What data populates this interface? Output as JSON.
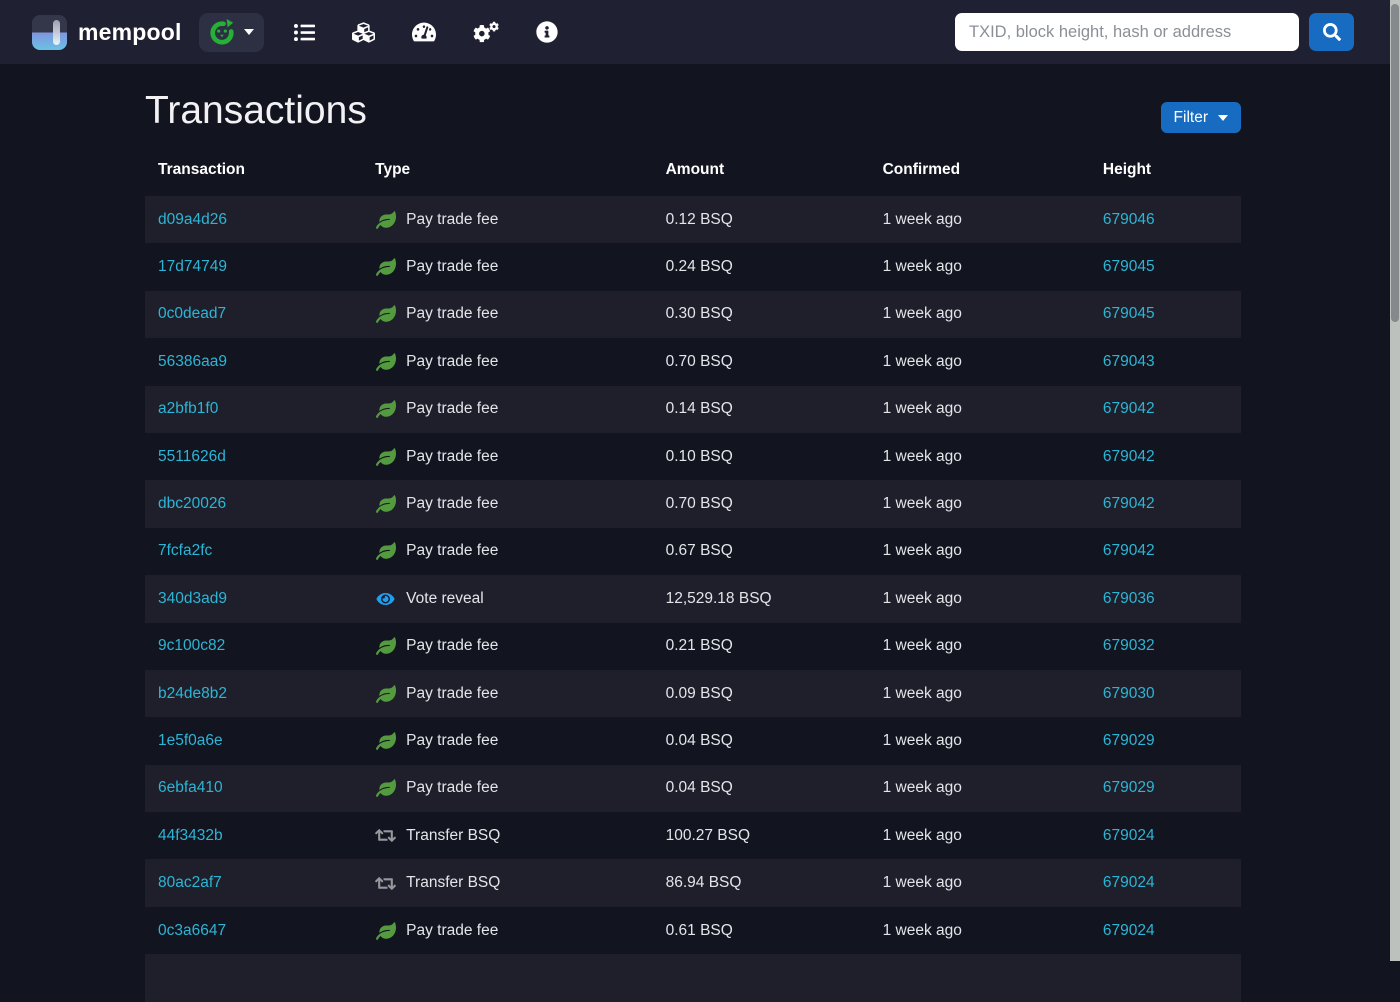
{
  "header": {
    "brand": "mempool",
    "network_selector": {
      "selected_network": "bisq"
    },
    "nav_icons": [
      {
        "name": "transactions-list-icon"
      },
      {
        "name": "blocks-icon"
      },
      {
        "name": "dashboard-icon"
      },
      {
        "name": "settings-icon"
      },
      {
        "name": "about-icon"
      }
    ],
    "search_placeholder": "TXID, block height, hash or address"
  },
  "page": {
    "title": "Transactions",
    "filter_label": "Filter"
  },
  "table": {
    "columns": [
      "Transaction",
      "Type",
      "Amount",
      "Confirmed",
      "Height"
    ],
    "rows": [
      {
        "txid": "d09a4d26",
        "icon": "leaf",
        "type": "Pay trade fee",
        "amount": "0.12 BSQ",
        "confirmed": "1 week ago",
        "height": "679046"
      },
      {
        "txid": "17d74749",
        "icon": "leaf",
        "type": "Pay trade fee",
        "amount": "0.24 BSQ",
        "confirmed": "1 week ago",
        "height": "679045"
      },
      {
        "txid": "0c0dead7",
        "icon": "leaf",
        "type": "Pay trade fee",
        "amount": "0.30 BSQ",
        "confirmed": "1 week ago",
        "height": "679045"
      },
      {
        "txid": "56386aa9",
        "icon": "leaf",
        "type": "Pay trade fee",
        "amount": "0.70 BSQ",
        "confirmed": "1 week ago",
        "height": "679043"
      },
      {
        "txid": "a2bfb1f0",
        "icon": "leaf",
        "type": "Pay trade fee",
        "amount": "0.14 BSQ",
        "confirmed": "1 week ago",
        "height": "679042"
      },
      {
        "txid": "5511626d",
        "icon": "leaf",
        "type": "Pay trade fee",
        "amount": "0.10 BSQ",
        "confirmed": "1 week ago",
        "height": "679042"
      },
      {
        "txid": "dbc20026",
        "icon": "leaf",
        "type": "Pay trade fee",
        "amount": "0.70 BSQ",
        "confirmed": "1 week ago",
        "height": "679042"
      },
      {
        "txid": "7fcfa2fc",
        "icon": "leaf",
        "type": "Pay trade fee",
        "amount": "0.67 BSQ",
        "confirmed": "1 week ago",
        "height": "679042"
      },
      {
        "txid": "340d3ad9",
        "icon": "eye",
        "type": "Vote reveal",
        "amount": "12,529.18 BSQ",
        "confirmed": "1 week ago",
        "height": "679036"
      },
      {
        "txid": "9c100c82",
        "icon": "leaf",
        "type": "Pay trade fee",
        "amount": "0.21 BSQ",
        "confirmed": "1 week ago",
        "height": "679032"
      },
      {
        "txid": "b24de8b2",
        "icon": "leaf",
        "type": "Pay trade fee",
        "amount": "0.09 BSQ",
        "confirmed": "1 week ago",
        "height": "679030"
      },
      {
        "txid": "1e5f0a6e",
        "icon": "leaf",
        "type": "Pay trade fee",
        "amount": "0.04 BSQ",
        "confirmed": "1 week ago",
        "height": "679029"
      },
      {
        "txid": "6ebfa410",
        "icon": "leaf",
        "type": "Pay trade fee",
        "amount": "0.04 BSQ",
        "confirmed": "1 week ago",
        "height": "679029"
      },
      {
        "txid": "44f3432b",
        "icon": "retweet",
        "type": "Transfer BSQ",
        "amount": "100.27 BSQ",
        "confirmed": "1 week ago",
        "height": "679024"
      },
      {
        "txid": "80ac2af7",
        "icon": "retweet",
        "type": "Transfer BSQ",
        "amount": "86.94 BSQ",
        "confirmed": "1 week ago",
        "height": "679024"
      },
      {
        "txid": "0c3a6647",
        "icon": "leaf",
        "type": "Pay trade fee",
        "amount": "0.61 BSQ",
        "confirmed": "1 week ago",
        "height": "679024"
      }
    ]
  },
  "colors": {
    "navbar_bg": "#1f2133",
    "body_bg": "#12141f",
    "accent_blue": "#176bc1",
    "link_cyan": "#2cb5d6",
    "leaf_green": "#549b3f",
    "eye_blue": "#1f9ff2",
    "retweet_gray": "#97979d",
    "bisq_green": "#25b135"
  }
}
